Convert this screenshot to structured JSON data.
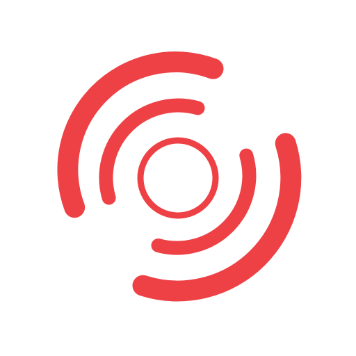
{
  "icon": {
    "name": "radar-signal-icon",
    "color": "#EE4145",
    "background": "#FFFFFF"
  }
}
